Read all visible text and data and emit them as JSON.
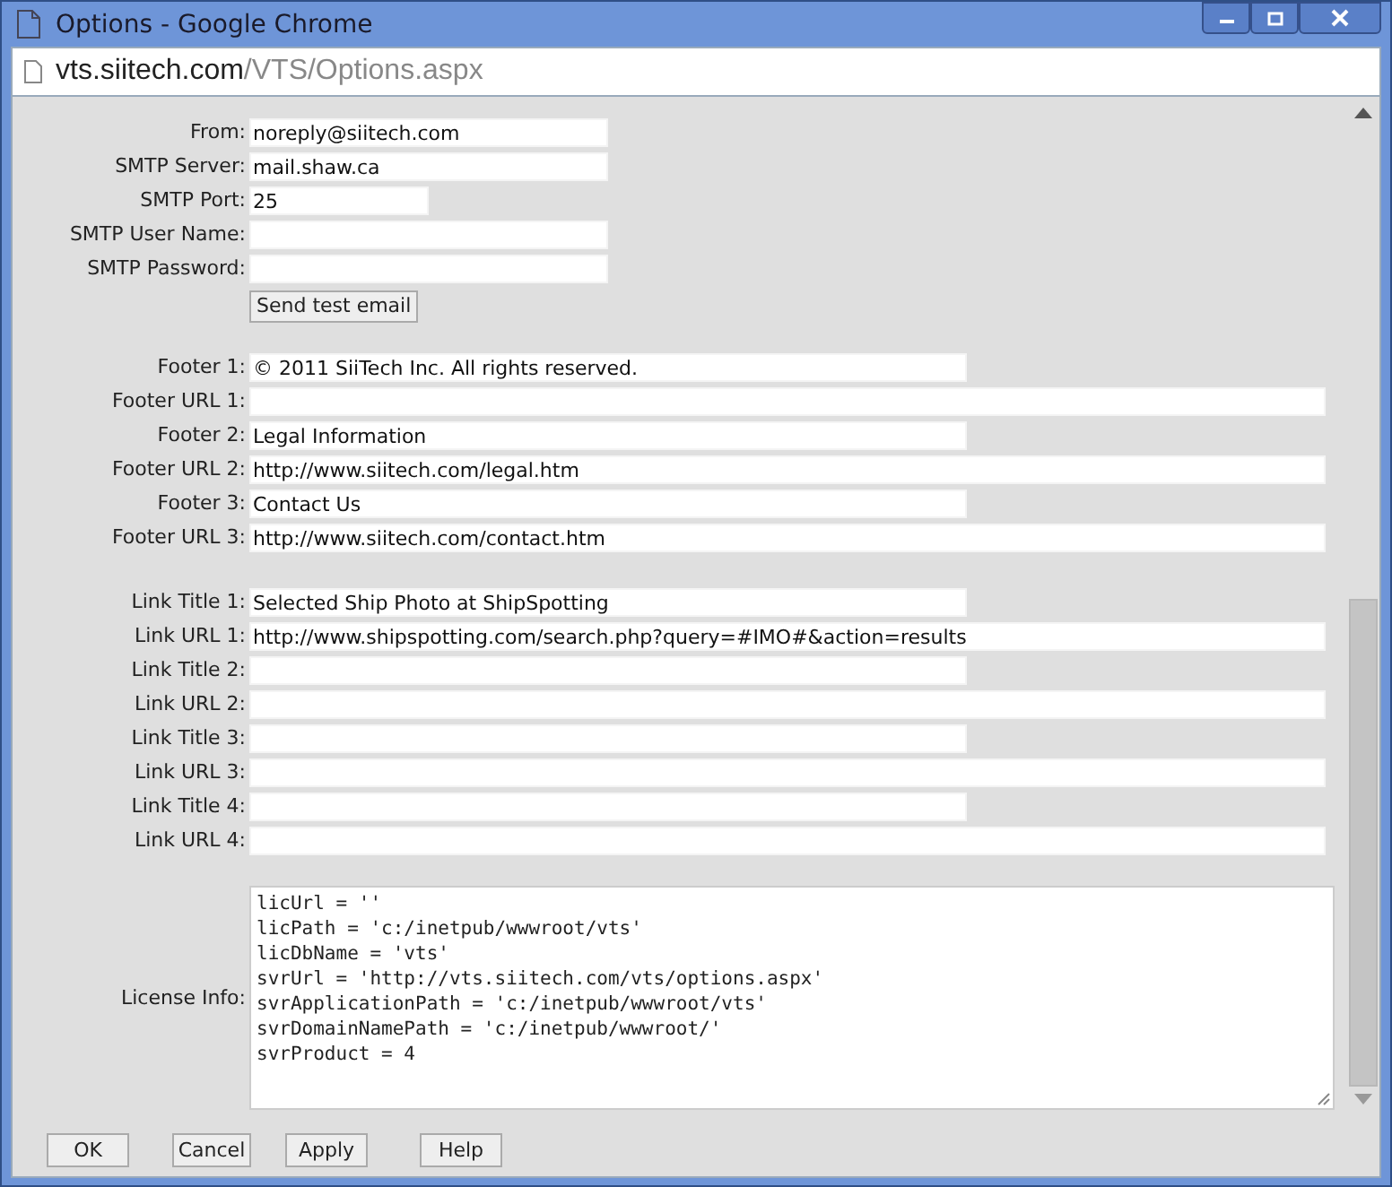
{
  "window": {
    "title": "Options - Google Chrome"
  },
  "address": {
    "host": "vts.siitech.com",
    "path": "/VTS/Options.aspx"
  },
  "groups": [
    {
      "rows": [
        {
          "label": "From:",
          "value": "noreply@siitech.com",
          "kind": "short"
        },
        {
          "label": "SMTP Server:",
          "value": "mail.shaw.ca",
          "kind": "short"
        },
        {
          "label": "SMTP Port:",
          "value": "25",
          "kind": "port"
        },
        {
          "label": "SMTP User Name:",
          "kind": "short"
        },
        {
          "label": "SMTP Password:",
          "kind": "short"
        }
      ],
      "button": "Send test email"
    },
    {
      "rows": [
        {
          "label": "Footer 1:",
          "value": "© 2011 SiiTech Inc. All rights reserved.",
          "kind": "title"
        },
        {
          "label": "Footer URL 1:",
          "kind": "url"
        },
        {
          "label": "Footer 2:",
          "value": "Legal Information",
          "kind": "title"
        },
        {
          "label": "Footer URL 2:",
          "value": "http://www.siitech.com/legal.htm",
          "kind": "url"
        },
        {
          "label": "Footer 3:",
          "value": "Contact Us",
          "kind": "title"
        },
        {
          "label": "Footer URL 3:",
          "value": "http://www.siitech.com/contact.htm",
          "kind": "url"
        }
      ]
    },
    {
      "rows": [
        {
          "label": "Link Title 1:",
          "value": "Selected Ship Photo at ShipSpotting",
          "kind": "title"
        },
        {
          "label": "Link URL 1:",
          "value": "http://www.shipspotting.com/search.php?query=#IMO#&action=results",
          "kind": "url"
        },
        {
          "label": "Link Title 2:",
          "kind": "title"
        },
        {
          "label": "Link URL 2:",
          "kind": "url"
        },
        {
          "label": "Link Title 3:",
          "kind": "title"
        },
        {
          "label": "Link URL 3:",
          "kind": "url"
        },
        {
          "label": "Link Title 4:",
          "kind": "title"
        },
        {
          "label": "Link URL 4:",
          "kind": "url"
        }
      ]
    }
  ],
  "license": {
    "label": "License Info:",
    "lines": [
      "licUrl = ''",
      "licPath = 'c:/inetpub/wwwroot/vts'",
      "licDbName = 'vts'",
      "svrUrl = 'http://vts.siitech.com/vts/options.aspx'",
      "svrApplicationPath = 'c:/inetpub/wwwroot/vts'",
      "svrDomainNamePath = 'c:/inetpub/wwwroot/'",
      "svrProduct = 4"
    ]
  },
  "buttons": [
    "OK",
    "Cancel",
    "Apply",
    "Help"
  ]
}
